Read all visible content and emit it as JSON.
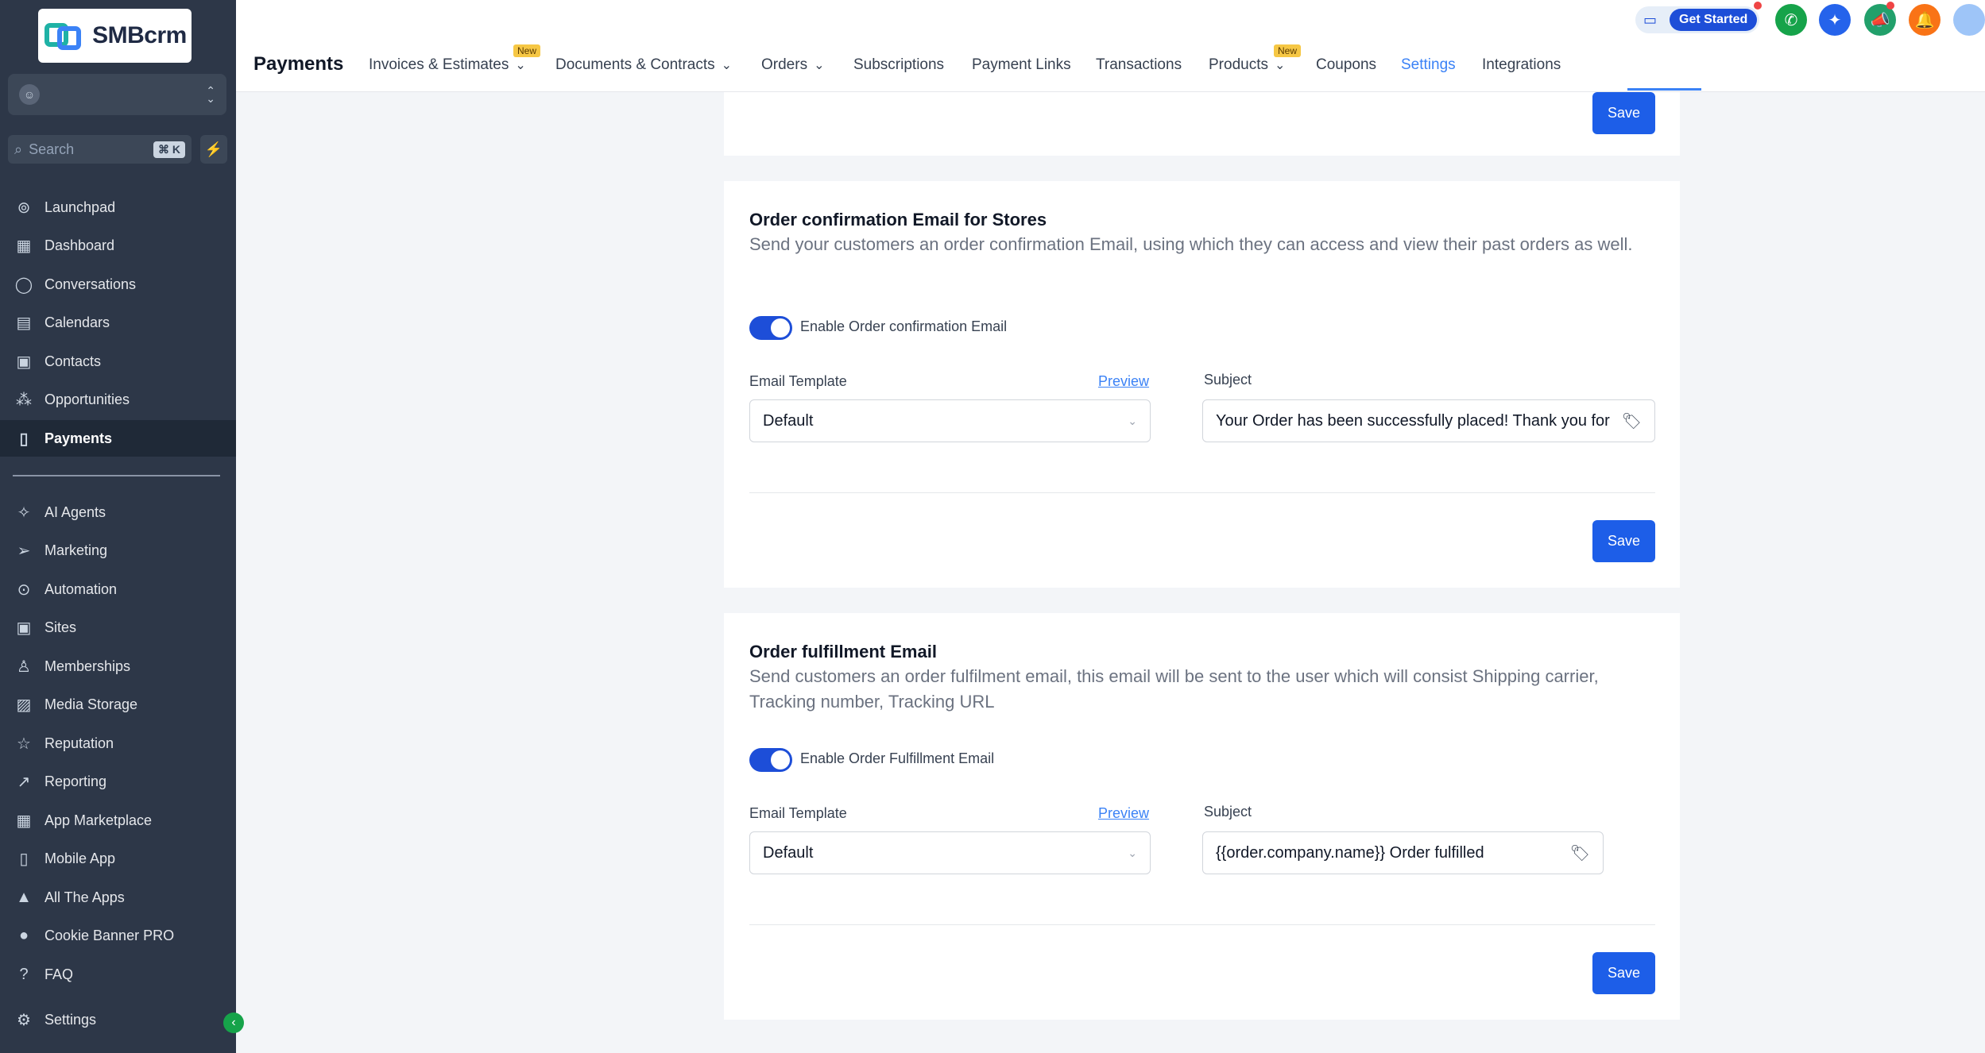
{
  "brand": {
    "name": "SMBcrm"
  },
  "sidebar": {
    "search_placeholder": "Search",
    "search_shortcut": "⌘ K",
    "items": [
      {
        "label": "Launchpad",
        "icon": "rocket-icon"
      },
      {
        "label": "Dashboard",
        "icon": "grid-icon"
      },
      {
        "label": "Conversations",
        "icon": "chat-icon"
      },
      {
        "label": "Calendars",
        "icon": "calendar-icon"
      },
      {
        "label": "Contacts",
        "icon": "contacts-icon"
      },
      {
        "label": "Opportunities",
        "icon": "opportunities-icon"
      },
      {
        "label": "Payments",
        "icon": "payments-icon",
        "active": true
      },
      {
        "label": "AI Agents",
        "icon": "ai-icon"
      },
      {
        "label": "Marketing",
        "icon": "send-icon"
      },
      {
        "label": "Automation",
        "icon": "automation-icon"
      },
      {
        "label": "Sites",
        "icon": "sites-icon"
      },
      {
        "label": "Memberships",
        "icon": "memberships-icon"
      },
      {
        "label": "Media Storage",
        "icon": "media-icon"
      },
      {
        "label": "Reputation",
        "icon": "star-icon"
      },
      {
        "label": "Reporting",
        "icon": "chart-icon"
      },
      {
        "label": "App Marketplace",
        "icon": "apps-icon"
      },
      {
        "label": "Mobile App",
        "icon": "mobile-icon"
      },
      {
        "label": "All The Apps",
        "icon": "all-apps-icon"
      },
      {
        "label": "Cookie Banner PRO",
        "icon": "cookie-icon"
      },
      {
        "label": "FAQ",
        "icon": "question-icon"
      },
      {
        "label": "Settings",
        "icon": "gear-icon"
      }
    ]
  },
  "header": {
    "title": "Payments",
    "tabs": [
      {
        "label": "Invoices & Estimates",
        "badge": "New",
        "dropdown": true
      },
      {
        "label": "Documents & Contracts",
        "dropdown": true
      },
      {
        "label": "Orders",
        "dropdown": true
      },
      {
        "label": "Subscriptions"
      },
      {
        "label": "Payment Links"
      },
      {
        "label": "Transactions"
      },
      {
        "label": "Products",
        "badge": "New",
        "dropdown": true
      },
      {
        "label": "Coupons"
      },
      {
        "label": "Settings",
        "active": true
      },
      {
        "label": "Integrations"
      }
    ],
    "get_started": "Get Started",
    "colors": {
      "accent": "#3b82f6",
      "phone": "#16a34a",
      "ai": "#2563eb",
      "announce": "#22a06b",
      "bell": "#f97316"
    }
  },
  "cards": {
    "top": {
      "save": "Save"
    },
    "order_confirmation": {
      "title": "Order confirmation Email for Stores",
      "description": "Send your customers an order confirmation Email, using which they can access and view their past orders as well.",
      "toggle_label": "Enable Order confirmation Email",
      "template_label": "Email Template",
      "preview": "Preview",
      "template_value": "Default",
      "subject_label": "Subject",
      "subject_value": "Your Order has been successfully placed! Thank you for shopping with us.",
      "save": "Save"
    },
    "order_fulfillment": {
      "title": "Order fulfillment Email",
      "description": "Send customers an order fulfilment email, this email will be sent to the user which will consist Shipping carrier, Tracking number, Tracking URL",
      "toggle_label": "Enable Order Fulfillment Email",
      "template_label": "Email Template",
      "preview": "Preview",
      "template_value": "Default",
      "subject_label": "Subject",
      "subject_value": "{{order.company.name}} Order fulfilled",
      "save": "Save"
    }
  }
}
